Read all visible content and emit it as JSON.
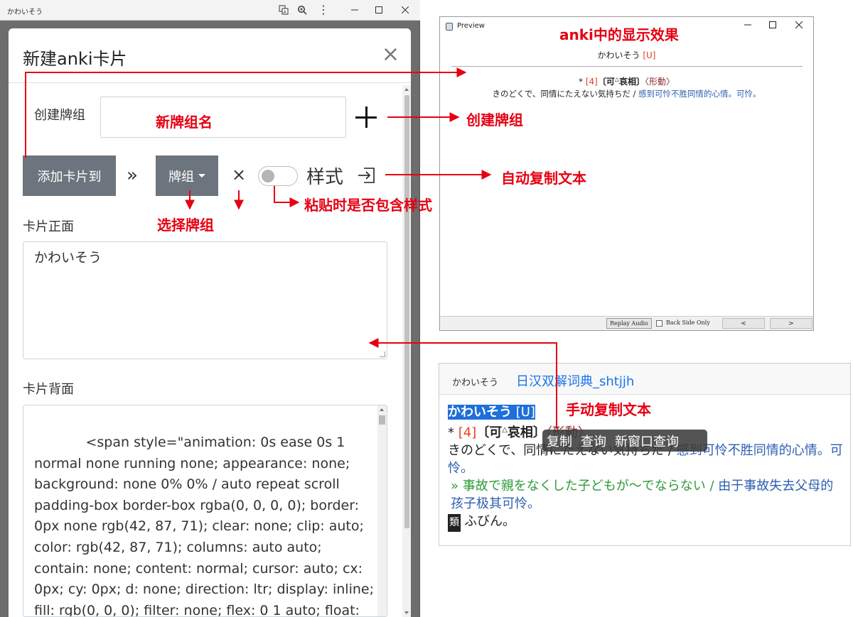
{
  "left_window": {
    "title": "かわいそう",
    "modal_title": "新建anki卡片",
    "close_glyph": "×",
    "create_deck_label": "创建牌组",
    "add_card_label": "添加卡片到",
    "chevron_glyph": "»",
    "deck_button": "牌组",
    "clear_glyph": "×",
    "style_label": "样式",
    "front_label": "卡片正面",
    "front_value": "かわいそう",
    "back_label": "卡片背面",
    "back_value": "            <span style=\"animation: 0s ease 0s 1 normal none running none; appearance: none; background: none 0% 0% / auto repeat scroll padding-box border-box rgba(0, 0, 0, 0); border: 0px none rgb(42, 87, 71); clear: none; clip: auto; color: rgb(42, 87, 71); columns: auto auto; contain: none; content: normal; cursor: auto; cx: 0px; cy: 0px; d: none; direction: ltr; display: inline; fill: rgb(0, 0, 0); filter: none; flex: 0 1 auto; float:"
  },
  "preview": {
    "title": "Preview",
    "word": "かわいそう",
    "tag": "[U]",
    "line1_prefix": "* ",
    "line1_num": "[4]",
    "line1_kanji": "〔可",
    "line1_accent": "△",
    "line1_kanji2": "哀相〕",
    "line1_pos": "〈形動〉",
    "line2_jp": "きのどくで、同情にたえない気持ちだ / ",
    "line2_cn": "感到可怜不胜同情的心情。可怜。",
    "replay": "Replay Audio",
    "back_only": "Back Side Only",
    "prev": "<",
    "next": ">"
  },
  "dictionary": {
    "word": "かわいそう",
    "dict_name": "日汉双解词典_shtjjh",
    "headword": "かわいそう",
    "tag": "[U]",
    "line1_prefix": "* ",
    "line1_num": "[4]",
    "line1_kanji": "〔可",
    "line1_accent": "△",
    "line1_kanji2": "哀相〕",
    "line1_pos": "〈形動〉",
    "def_jp": "きのどくで、同情にたえない気持ちだ / ",
    "def_cn": "感到可怜不胜同情的心情。可怜。",
    "ex_mark": "» ",
    "ex_jp": "事故で親をなくした子どもが～でならない / ",
    "ex_cn": "由于事故失去父母的孩子极其可怜。",
    "rui_badge": "類",
    "rui_text": "ふびん。",
    "context_menu": [
      "复制",
      "查询",
      "新窗口查询"
    ]
  },
  "annotations": {
    "anki_display": "anki中的显示效果",
    "new_deck_name": "新牌组名",
    "create_deck": "创建牌组",
    "auto_copy": "自动复制文本",
    "paste_style": "粘贴时是否包含样式",
    "select_deck": "选择牌组",
    "manual_copy": "手动复制文本"
  },
  "colors": {
    "annotation_red": "#e60012",
    "button_gray": "#6c757d",
    "link_blue": "#1a73e8",
    "highlight_blue": "#1e6fd9",
    "example_green": "#2e9a3a",
    "accent_orange": "#e8401c"
  }
}
